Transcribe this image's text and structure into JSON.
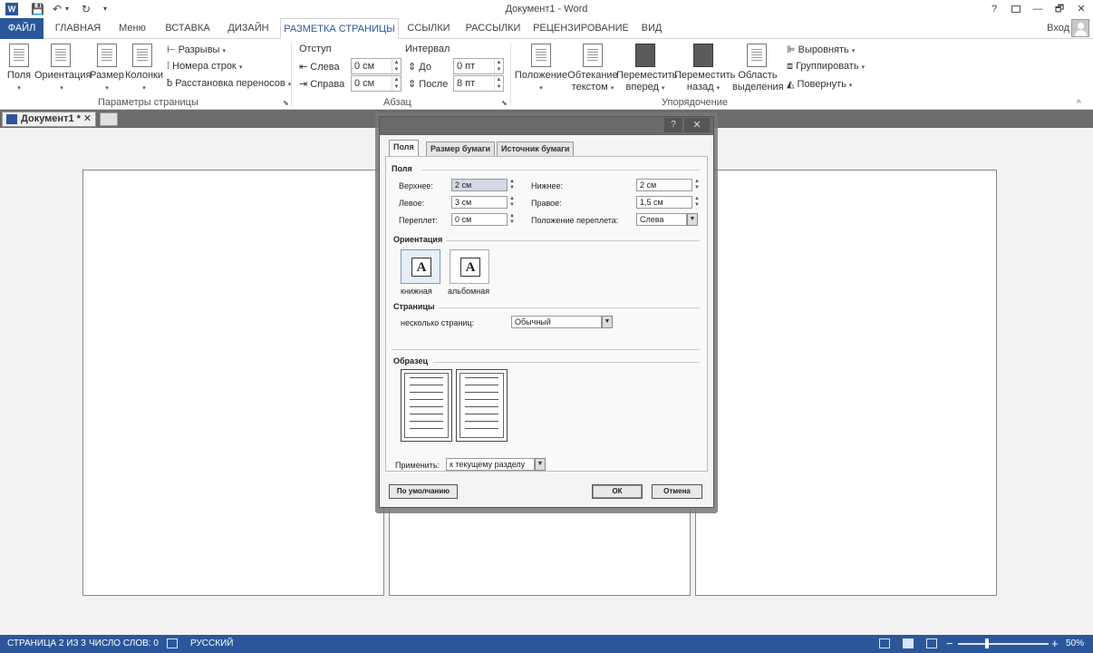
{
  "window": {
    "title": "Документ1 - Word",
    "app_badge": "W",
    "help": "?",
    "signin": "Вход",
    "minimize": "—",
    "restore": "🗗",
    "close": "✕"
  },
  "qat": {
    "save": "💾",
    "undo": "↶",
    "undo_drop": "▾",
    "redo": "↻",
    "custom": "▾"
  },
  "tabs": [
    {
      "label": "ФАЙЛ"
    },
    {
      "label": "ГЛАВНАЯ"
    },
    {
      "label": "Меню"
    },
    {
      "label": "ВСТАВКА"
    },
    {
      "label": "ДИЗАЙН"
    },
    {
      "label": "РАЗМЕТКА СТРАНИЦЫ"
    },
    {
      "label": "ССЫЛКИ"
    },
    {
      "label": "РАССЫЛКИ"
    },
    {
      "label": "РЕЦЕНЗИРОВАНИЕ"
    },
    {
      "label": "ВИД"
    }
  ],
  "ribbon": {
    "page_setup": {
      "label": "Параметры страницы",
      "margins": "Поля",
      "orientation": "Ориентация",
      "size": "Размер",
      "columns": "Колонки",
      "breaks": "Разрывы",
      "line_numbers": "Номера строк",
      "hyphenation": "Расстановка переносов",
      "launcher": "⬊"
    },
    "paragraph": {
      "label": "Абзац",
      "indent": "Отступ",
      "spacing": "Интервал",
      "left": "Слева",
      "right": "Справа",
      "before": "До",
      "after": "После",
      "left_val": "0 см",
      "right_val": "0 см",
      "before_val": "0 пт",
      "after_val": "8 пт",
      "launcher": "⬊"
    },
    "arrange": {
      "label": "Упорядочение",
      "position": "Положение",
      "wrap_1": "Обтекание",
      "wrap_2": "текстом",
      "forward_1": "Переместить",
      "forward_2": "вперед",
      "backward_1": "Переместить",
      "backward_2": "назад",
      "pane_1": "Область",
      "pane_2": "выделения",
      "align": "Выровнять",
      "group": "Группировать",
      "rotate": "Повернуть"
    },
    "collapse": "^"
  },
  "document": {
    "tab_label": "Документ1 *",
    "tab_close": "✕"
  },
  "dialog": {
    "tabs": [
      "Поля",
      "Размер бумаги",
      "Источник бумаги"
    ],
    "help": "?",
    "close": "✕",
    "margins": {
      "section": "Поля",
      "top_label": "Верхнее:",
      "top_val": "2 см",
      "bottom_label": "Нижнее:",
      "bottom_val": "2 см",
      "left_label": "Левое:",
      "left_val": "3 см",
      "right_label": "Правое:",
      "right_val": "1,5 см",
      "gutter_label": "Переплет:",
      "gutter_val": "0 см",
      "gutter_pos_label": "Положение переплета:",
      "gutter_pos_val": "Слева"
    },
    "orientation": {
      "section": "Ориентация",
      "portrait": "книжная",
      "landscape": "альбомная",
      "glyph": "A"
    },
    "pages": {
      "section": "Страницы",
      "multiple_label": "несколько страниц:",
      "multiple_val": "Обычный"
    },
    "preview": {
      "section": "Образец"
    },
    "apply": {
      "label": "Применить:",
      "value": "к текущему разделу"
    },
    "buttons": {
      "default": "По умолчанию",
      "ok": "ОК",
      "cancel": "Отмена"
    }
  },
  "status": {
    "page": "СТРАНИЦА 2 ИЗ 3",
    "words": "ЧИСЛО СЛОВ: 0",
    "language": "РУССКИЙ",
    "zoom_minus": "−",
    "zoom_plus": "+",
    "zoom": "50%"
  },
  "zoom_level": 0.5
}
